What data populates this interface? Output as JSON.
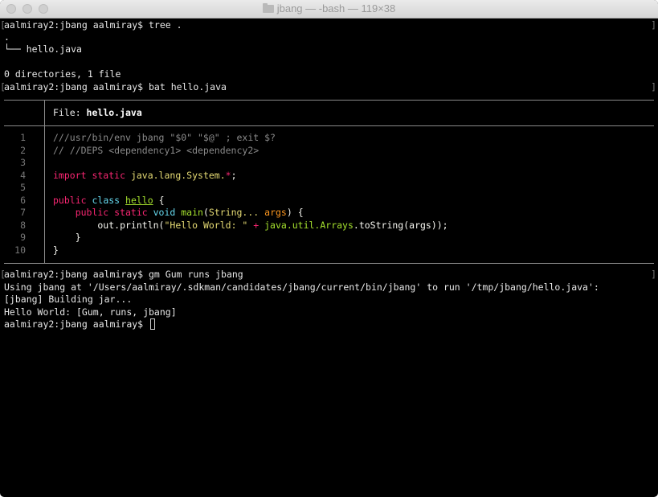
{
  "window": {
    "title": "jbang — -bash — 119×38"
  },
  "terminal": {
    "prompt1": "aalmiray2:jbang aalmiray$ tree .",
    "tree_root": ".",
    "tree_item": "└── hello.java",
    "tree_summary": "0 directories, 1 file",
    "prompt2": "aalmiray2:jbang aalmiray$ bat hello.java",
    "bat_file_label": "File: ",
    "bat_file_name": "hello.java",
    "code_lines": [
      {
        "n": "1",
        "parts": [
          {
            "t": "///usr/bin/env jbang \"$0\" \"$@\" ; exit $?",
            "c": "cm"
          }
        ]
      },
      {
        "n": "2",
        "parts": [
          {
            "t": "// //DEPS <dependency1> <dependency2>",
            "c": "cm"
          }
        ]
      },
      {
        "n": "3",
        "parts": []
      },
      {
        "n": "4",
        "parts": [
          {
            "t": "import static ",
            "c": "kw"
          },
          {
            "t": "java.lang.System.",
            "c": "yl"
          },
          {
            "t": "*",
            "c": "kw"
          },
          {
            "t": ";",
            "c": "wh"
          }
        ]
      },
      {
        "n": "5",
        "parts": []
      },
      {
        "n": "6",
        "parts": [
          {
            "t": "public ",
            "c": "kw"
          },
          {
            "t": "class ",
            "c": "kb"
          },
          {
            "t": "hello",
            "c": "cls"
          },
          {
            "t": " {",
            "c": "wh"
          }
        ]
      },
      {
        "n": "7",
        "parts": [
          {
            "t": "    public static ",
            "c": "kw"
          },
          {
            "t": "void ",
            "c": "kb"
          },
          {
            "t": "main",
            "c": "fn"
          },
          {
            "t": "(",
            "c": "wh"
          },
          {
            "t": "String... ",
            "c": "yl"
          },
          {
            "t": "args",
            "c": "or"
          },
          {
            "t": ") {",
            "c": "wh"
          }
        ]
      },
      {
        "n": "8",
        "parts": [
          {
            "t": "        out.println(",
            "c": "wh"
          },
          {
            "t": "\"Hello World: \" ",
            "c": "yl"
          },
          {
            "t": "+ ",
            "c": "kw"
          },
          {
            "t": "java.util.Arrays",
            "c": "fn"
          },
          {
            "t": ".toString(args));",
            "c": "wh"
          }
        ]
      },
      {
        "n": "9",
        "parts": [
          {
            "t": "    }",
            "c": "wh"
          }
        ]
      },
      {
        "n": "10",
        "parts": [
          {
            "t": "}",
            "c": "wh"
          }
        ]
      }
    ],
    "prompt3": "aalmiray2:jbang aalmiray$ gm Gum runs jbang",
    "output1": "Using jbang at '/Users/aalmiray/.sdkman/candidates/jbang/current/bin/jbang' to run '/tmp/jbang/hello.java':",
    "output2": "[jbang] Building jar...",
    "output3": "Hello World: [Gum, runs, jbang]",
    "prompt4": "aalmiray2:jbang aalmiray$ "
  }
}
